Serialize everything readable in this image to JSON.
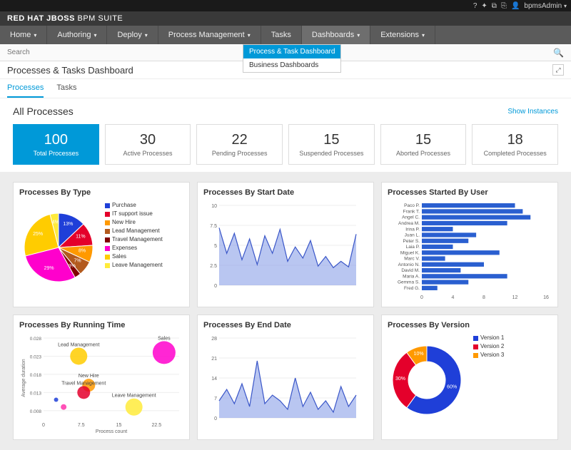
{
  "topbar_icons": [
    "?",
    "✦",
    "⧉",
    "⎘"
  ],
  "user": "bpmsAdmin",
  "brand_prefix": "RED HAT JBOSS",
  "brand_suffix": "BPM SUITE",
  "nav": [
    {
      "label": "Home"
    },
    {
      "label": "Authoring"
    },
    {
      "label": "Deploy"
    },
    {
      "label": "Process Management"
    },
    {
      "label": "Tasks",
      "no_chev": true
    },
    {
      "label": "Dashboards",
      "active": true
    },
    {
      "label": "Extensions"
    }
  ],
  "dropdown": [
    {
      "label": "Process & Task Dashboard",
      "sel": true
    },
    {
      "label": "Business Dashboards"
    }
  ],
  "search_placeholder": "Search",
  "page_title": "Processes & Tasks Dashboard",
  "tabs": [
    {
      "label": "Processes",
      "active": true
    },
    {
      "label": "Tasks"
    }
  ],
  "section_title": "All Processes",
  "show_instances": "Show Instances",
  "kpis": [
    {
      "num": "100",
      "lbl": "Total Processes",
      "hl": true
    },
    {
      "num": "30",
      "lbl": "Active Processes"
    },
    {
      "num": "22",
      "lbl": "Pending Processes"
    },
    {
      "num": "15",
      "lbl": "Suspended Processes"
    },
    {
      "num": "15",
      "lbl": "Aborted Processes"
    },
    {
      "num": "18",
      "lbl": "Completed Processes"
    }
  ],
  "cards": {
    "by_type": {
      "title": "Processes By Type"
    },
    "by_start": {
      "title": "Processes By Start Date"
    },
    "by_user": {
      "title": "Processes Started By User"
    },
    "by_runtime": {
      "title": "Processes By Running Time"
    },
    "by_end": {
      "title": "Processes By End Date"
    },
    "by_version": {
      "title": "Processes By Version"
    }
  },
  "chart_data": [
    {
      "type": "pie",
      "title": "Processes By Type",
      "series": [
        {
          "name": "Purchase",
          "value": 13,
          "color": "#1f3fd8"
        },
        {
          "name": "IT support issue",
          "value": 11,
          "color": "#e4002b"
        },
        {
          "name": "New Hire",
          "value": 8,
          "color": "#ff9900"
        },
        {
          "name": "Lead Management",
          "value": 7,
          "color": "#b35a1e"
        },
        {
          "name": "Travel Management",
          "value": 3,
          "color": "#800000"
        },
        {
          "name": "Expenses",
          "value": 29,
          "color": "#ff00cc"
        },
        {
          "name": "Sales",
          "value": 25,
          "color": "#ffcc00"
        },
        {
          "name": "Leave Management",
          "value": 4,
          "color": "#ffeb3b"
        }
      ]
    },
    {
      "type": "area",
      "title": "Processes By Start Date",
      "ylim": [
        0,
        10
      ],
      "yticks": [
        0.0,
        2.5,
        5.0,
        7.5,
        10.0
      ],
      "values": [
        7.2,
        4,
        6.5,
        3.2,
        5.8,
        2.6,
        6.2,
        4,
        7,
        3,
        4.8,
        3.4,
        5.6,
        2.4,
        3.6,
        2.2,
        3.0,
        2.3,
        6.4
      ]
    },
    {
      "type": "bar",
      "title": "Processes Started By User",
      "orientation": "h",
      "categories": [
        "Paco P.",
        "Frank T.",
        "Angel C.",
        "Andrea M.",
        "Irina P.",
        "Juan L.",
        "Peter S.",
        "Laia P.",
        "Miguel K.",
        "Marc V.",
        "Antonio N.",
        "David M.",
        "Maria A.",
        "Gemma S.",
        "Fred G."
      ],
      "values": [
        12,
        13,
        14,
        11,
        4,
        7,
        6,
        4,
        10,
        3,
        8,
        5,
        11,
        6,
        2
      ],
      "xticks": [
        0,
        4,
        8,
        12,
        16
      ],
      "color": "#2a5fd0"
    },
    {
      "type": "scatter",
      "title": "Processes By Running Time",
      "xlabel": "Process count",
      "ylabel": "Average duration",
      "xlim": [
        0,
        27
      ],
      "ylim": [
        0.006,
        0.028
      ],
      "xticks": [
        0,
        7.5,
        15,
        22.5
      ],
      "yticks": [
        0.008,
        0.013,
        0.018,
        0.023,
        0.028
      ],
      "points": [
        {
          "name": "Lead Management",
          "x": 7,
          "y": 0.023,
          "r": 12,
          "color": "#ffcc00"
        },
        {
          "name": "New Hire",
          "x": 9,
          "y": 0.015,
          "r": 9,
          "color": "#ff9900"
        },
        {
          "name": "Travel Management",
          "x": 8,
          "y": 0.013,
          "r": 9,
          "color": "#e4002b"
        },
        {
          "name": "Sales",
          "x": 24,
          "y": 0.024,
          "r": 16,
          "color": "#ff00cc"
        },
        {
          "name": "Leave Management",
          "x": 18,
          "y": 0.009,
          "r": 12,
          "color": "#ffeb3b"
        },
        {
          "name": "",
          "x": 4,
          "y": 0.009,
          "r": 4,
          "color": "#ff33aa"
        },
        {
          "name": "",
          "x": 2.5,
          "y": 0.011,
          "r": 3,
          "color": "#1f3fd8"
        }
      ]
    },
    {
      "type": "area",
      "title": "Processes By End Date",
      "ylim": [
        0,
        28
      ],
      "yticks": [
        0,
        7,
        14,
        21,
        28
      ],
      "values": [
        6,
        10,
        5,
        12,
        4,
        20,
        5,
        8,
        6,
        3,
        14,
        4,
        9,
        3,
        6,
        2,
        11,
        4,
        8
      ]
    },
    {
      "type": "pie",
      "subtype": "donut",
      "title": "Processes By Version",
      "series": [
        {
          "name": "Version 1",
          "value": 60,
          "color": "#1f3fd8"
        },
        {
          "name": "Version 2",
          "value": 30,
          "color": "#e4002b"
        },
        {
          "name": "Version 3",
          "value": 10,
          "color": "#ff9900"
        }
      ]
    }
  ]
}
